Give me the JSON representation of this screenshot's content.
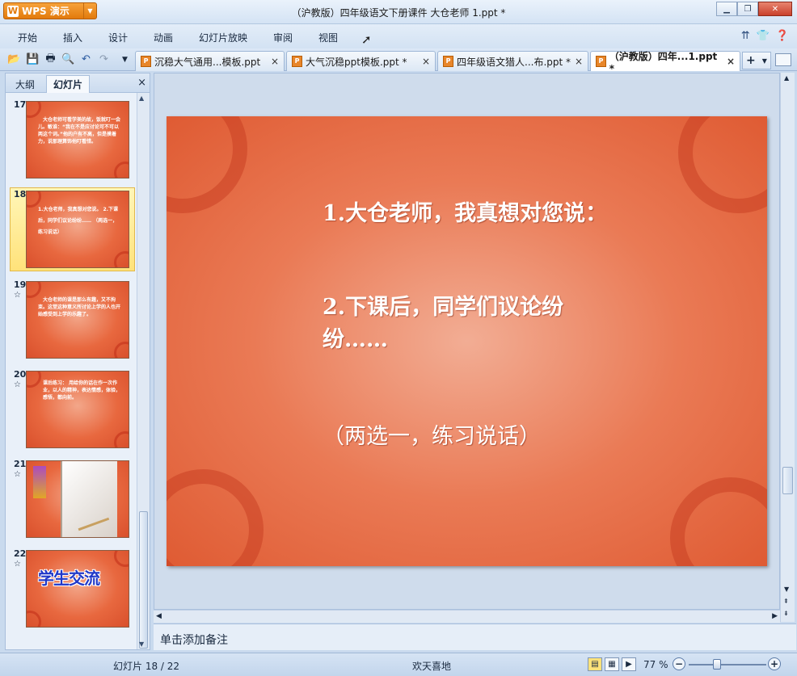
{
  "app": {
    "brand": "WPS 演示",
    "window_title": "（沪教版）四年级语文下册课件 大仓老师 1.ppt *"
  },
  "menu": [
    "开始",
    "插入",
    "设计",
    "动画",
    "幻灯片放映",
    "审阅",
    "视图"
  ],
  "doc_tabs": [
    {
      "label": "沉稳大气通用...模板.ppt",
      "close": "×"
    },
    {
      "label": "大气沉稳ppt模板.ppt *",
      "close": "×"
    },
    {
      "label": "四年级语文猎人...布.ppt *",
      "close": "×"
    },
    {
      "label": "（沪教版）四年...1.ppt *",
      "close": "×"
    }
  ],
  "left_panel": {
    "tabs": [
      "大纲",
      "幻灯片"
    ],
    "close": "×",
    "thumbnails": [
      {
        "num": "17",
        "star": "",
        "text": "　大仓老师可看学美的故，饭就叮一会儿。敏谁：“我在不是应讨论可不可以两这个词。”他的户有不高，但是摸着力，说那理算饰他叮看惜。"
      },
      {
        "num": "18",
        "star": "",
        "text": "1.大仓老师，我真想对您说。 2.下课后，同学们议论纷纷…… （两选一，练习说话）"
      },
      {
        "num": "19",
        "star": "☆",
        "text": "　大仓老师的课是那么有趣，又不拘束。这堂这种意义所讨论上学的人也开始感受到上学的乐趣了。"
      },
      {
        "num": "20",
        "star": "☆",
        "text": "课后练习： 用给你的话在作一次作业，以人的精神，表达情感，体验，感悟，都向前。"
      },
      {
        "num": "21",
        "star": "☆",
        "text": ""
      },
      {
        "num": "22",
        "star": "☆",
        "text": "学生交流"
      }
    ]
  },
  "slide": {
    "lines": [
      "1.大仓老师，我真想对您说：",
      "2.下课后，同学们议论纷",
      "纷……",
      "（两选一，练习说话）"
    ]
  },
  "notes": {
    "placeholder": "单击添加备注"
  },
  "status": {
    "slide_counter": "幻灯片 18 / 22",
    "theme": "欢天喜地",
    "zoom": "77 %",
    "zoom_level_percent": 77
  },
  "colors": {
    "accent": "#e8862a",
    "slide_base": "#e8683f",
    "selection": "#ffe27a"
  }
}
